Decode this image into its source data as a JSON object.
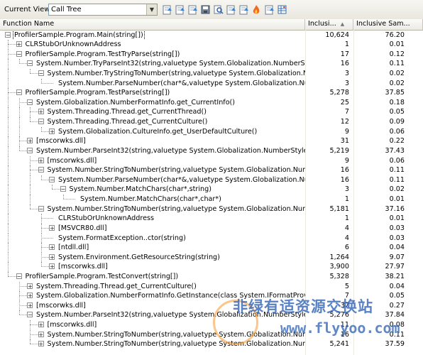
{
  "toolbar": {
    "current_view_label": "Current View:",
    "current_view_value": "Call Tree",
    "icons": [
      "export-icon",
      "copy-icon",
      "copy-stack-icon",
      "save-icon",
      "find-icon",
      "filter-icon",
      "settings-icon",
      "flame-icon",
      "extract-icon",
      "sheet-icon"
    ]
  },
  "columns": {
    "name": "Function Name",
    "inclusive": "Inclusi...",
    "inclusive_pct": "Inclusive Sam..."
  },
  "rows": [
    {
      "depth": 0,
      "exp": "-",
      "name": "ProfilerSample.Program.Main(string[])",
      "v1": "10,624",
      "v2": "76.20",
      "selected": true
    },
    {
      "depth": 1,
      "exp": "+",
      "name": "CLRStubOrUnknownAddress",
      "v1": "1",
      "v2": "0.01"
    },
    {
      "depth": 1,
      "exp": "-",
      "name": "ProfilerSample.Program.TestTryParse(string[])",
      "v1": "17",
      "v2": "0.12"
    },
    {
      "depth": 2,
      "exp": "-",
      "name": "System.Number.TryParseInt32(string,valuetype System.Globalization.NumberStyles,class System.Glob",
      "v1": "16",
      "v2": "0.11"
    },
    {
      "depth": 3,
      "exp": "-",
      "name": "System.Number.TryStringToNumber(string,valuetype System.Globalization.NumberStyles,valuet",
      "v1": "3",
      "v2": "0.02"
    },
    {
      "depth": 4,
      "exp": "",
      "name": "System.Number.ParseNumber(char*&,valuetype System.Globalization.NumberStyles,valu",
      "v1": "3",
      "v2": "0.02"
    },
    {
      "depth": 1,
      "exp": "-",
      "name": "ProfilerSample.Program.TestParse(string[])",
      "v1": "5,278",
      "v2": "37.85"
    },
    {
      "depth": 2,
      "exp": "-",
      "name": "System.Globalization.NumberFormatInfo.get_CurrentInfo()",
      "v1": "25",
      "v2": "0.18"
    },
    {
      "depth": 3,
      "exp": "+",
      "name": "System.Threading.Thread.get_CurrentThread()",
      "v1": "7",
      "v2": "0.05"
    },
    {
      "depth": 3,
      "exp": "-",
      "name": "System.Threading.Thread.get_CurrentCulture()",
      "v1": "12",
      "v2": "0.09"
    },
    {
      "depth": 4,
      "exp": "+",
      "name": "System.Globalization.CultureInfo.get_UserDefaultCulture()",
      "v1": "9",
      "v2": "0.06"
    },
    {
      "depth": 2,
      "exp": "+",
      "name": "[mscorwks.dll]",
      "v1": "31",
      "v2": "0.22"
    },
    {
      "depth": 2,
      "exp": "-",
      "name": "System.Number.ParseInt32(string,valuetype System.Globalization.NumberStyles,class System.Gl",
      "v1": "5,219",
      "v2": "37.43"
    },
    {
      "depth": 3,
      "exp": "+",
      "name": "[mscorwks.dll]",
      "v1": "9",
      "v2": "0.06"
    },
    {
      "depth": 3,
      "exp": "-",
      "name": "System.Number.StringToNumber(string,valuetype System.Globalization.NumberStyles,valuet",
      "v1": "16",
      "v2": "0.11"
    },
    {
      "depth": 4,
      "exp": "-",
      "name": "System.Number.ParseNumber(char*&,valuetype System.Globalization.NumberStyles,valu",
      "v1": "16",
      "v2": "0.11"
    },
    {
      "depth": 5,
      "exp": "-",
      "name": "System.Number.MatchChars(char*,string)",
      "v1": "3",
      "v2": "0.02"
    },
    {
      "depth": 6,
      "exp": "",
      "name": "System.Number.MatchChars(char*,char*)",
      "v1": "1",
      "v2": "0.01"
    },
    {
      "depth": 3,
      "exp": "-",
      "name": "System.Number.StringToNumber(string,valuetype System.Globalization.NumberStyles,valuet",
      "v1": "5,181",
      "v2": "37.16"
    },
    {
      "depth": 4,
      "exp": "",
      "name": "CLRStubOrUnknownAddress",
      "v1": "1",
      "v2": "0.01"
    },
    {
      "depth": 4,
      "exp": "+",
      "name": "[MSVCR80.dll]",
      "v1": "4",
      "v2": "0.03"
    },
    {
      "depth": 4,
      "exp": "",
      "name": "System.FormatException..ctor(string)",
      "v1": "4",
      "v2": "0.03"
    },
    {
      "depth": 4,
      "exp": "+",
      "name": "[ntdll.dll]",
      "v1": "6",
      "v2": "0.04"
    },
    {
      "depth": 4,
      "exp": "+",
      "name": "System.Environment.GetResourceString(string)",
      "v1": "1,264",
      "v2": "9.07"
    },
    {
      "depth": 4,
      "exp": "+",
      "name": "[mscorwks.dll]",
      "v1": "3,900",
      "v2": "27.97"
    },
    {
      "depth": 1,
      "exp": "-",
      "name": "ProfilerSample.Program.TestConvert(string[])",
      "v1": "5,328",
      "v2": "38.21"
    },
    {
      "depth": 2,
      "exp": "+",
      "name": "System.Threading.Thread.get_CurrentCulture()",
      "v1": "5",
      "v2": "0.04"
    },
    {
      "depth": 2,
      "exp": "+",
      "name": "System.Globalization.NumberFormatInfo.GetInstance(class System.IFormatProvider)",
      "v1": "7",
      "v2": "0.05"
    },
    {
      "depth": 2,
      "exp": "+",
      "name": "[mscorwks.dll]",
      "v1": "37",
      "v2": "0.27"
    },
    {
      "depth": 2,
      "exp": "-",
      "name": "System.Number.ParseInt32(string,valuetype System.Globalization.NumberStyles,class System.G",
      "v1": "5,276",
      "v2": "37.84"
    },
    {
      "depth": 3,
      "exp": "+",
      "name": "[mscorwks.dll]",
      "v1": "11",
      "v2": "0.08"
    },
    {
      "depth": 3,
      "exp": "+",
      "name": "System.Number.StringToNumber(string,valuetype System.Globalization.NumberStyles,valuet",
      "v1": "16",
      "v2": "0.11"
    },
    {
      "depth": 3,
      "exp": "+",
      "name": "System.Number.StringToNumber(string,valuetype System.Globalization.NumberStyles,valuet",
      "v1": "5,241",
      "v2": "37.59"
    }
  ],
  "watermark": {
    "line1": "非绿有适资源交换站",
    "line2": "www.flyyoo.com"
  }
}
